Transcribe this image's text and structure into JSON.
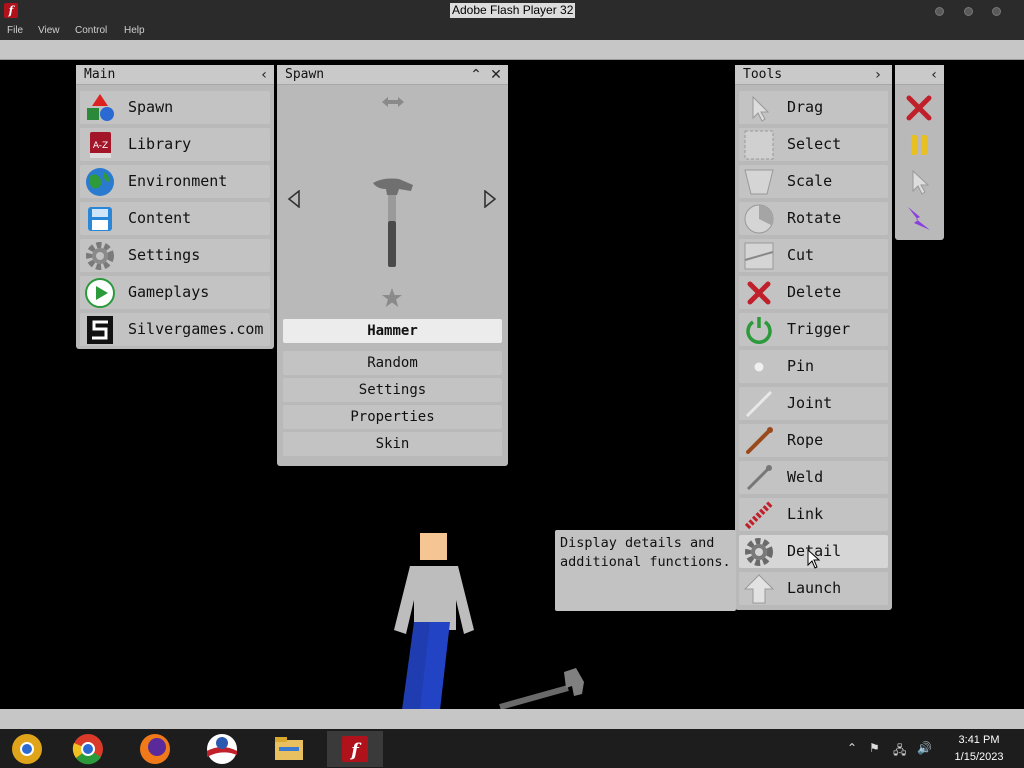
{
  "window": {
    "title": "Adobe Flash Player 32",
    "menu": [
      "File",
      "View",
      "Control",
      "Help"
    ]
  },
  "main_panel": {
    "title": "Main",
    "items": [
      {
        "label": "Spawn",
        "icon": "spawn-shapes-icon"
      },
      {
        "label": "Library",
        "icon": "library-book-icon"
      },
      {
        "label": "Environment",
        "icon": "globe-icon"
      },
      {
        "label": "Content",
        "icon": "floppy-disk-icon"
      },
      {
        "label": "Settings",
        "icon": "gear-icon"
      },
      {
        "label": "Gameplays",
        "icon": "play-icon"
      },
      {
        "label": "Silvergames.com",
        "icon": "silvergames-logo-icon"
      }
    ]
  },
  "spawn_panel": {
    "title": "Spawn",
    "selected_item": "Hammer",
    "buttons": [
      "Random",
      "Settings",
      "Properties",
      "Skin"
    ]
  },
  "tools_panel": {
    "title": "Tools",
    "items": [
      {
        "label": "Drag",
        "icon": "cursor-icon"
      },
      {
        "label": "Select",
        "icon": "select-box-icon"
      },
      {
        "label": "Scale",
        "icon": "scale-icon"
      },
      {
        "label": "Rotate",
        "icon": "rotate-icon"
      },
      {
        "label": "Cut",
        "icon": "cut-icon"
      },
      {
        "label": "Delete",
        "icon": "delete-x-icon"
      },
      {
        "label": "Trigger",
        "icon": "power-icon"
      },
      {
        "label": "Pin",
        "icon": "pin-dot-icon"
      },
      {
        "label": "Joint",
        "icon": "joint-line-icon"
      },
      {
        "label": "Rope",
        "icon": "rope-icon"
      },
      {
        "label": "Weld",
        "icon": "weld-icon"
      },
      {
        "label": "Link",
        "icon": "link-chain-icon"
      },
      {
        "label": "Detail",
        "icon": "gear-icon"
      },
      {
        "label": "Launch",
        "icon": "arrow-up-icon"
      }
    ],
    "hovered_item": "Detail"
  },
  "tooltip": {
    "text": "Display details and additional functions."
  },
  "mini_panel": {
    "buttons": [
      "clear-x-icon",
      "pause-icon",
      "cursor-icon",
      "lightning-icon"
    ]
  },
  "taskbar": {
    "apps": [
      "chrome-canary-icon",
      "chrome-icon",
      "firefox-icon",
      "obama-logo-icon",
      "file-explorer-icon",
      "flash-player-icon"
    ],
    "time": "3:41 PM",
    "date": "1/15/2023"
  },
  "colors": {
    "panel_bg": "#b9b9b9",
    "row_bg": "#c3c3c3",
    "highlight": "#ececec",
    "delete_red": "#c0202a",
    "pause_yellow": "#e8c020",
    "lightning_purple": "#8a3ee0"
  }
}
